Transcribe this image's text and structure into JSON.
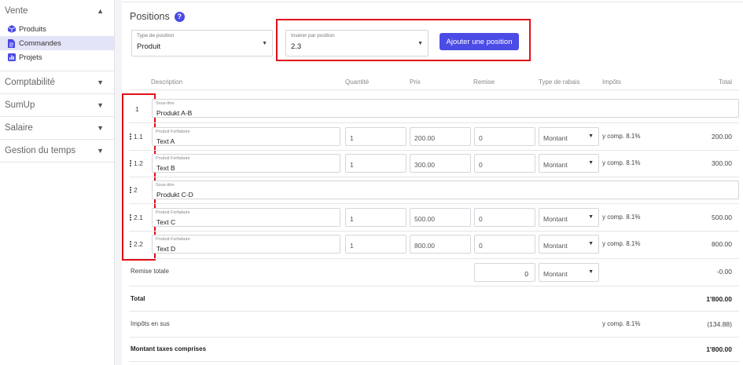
{
  "sidebar": {
    "vente": {
      "label": "Vente",
      "items": [
        {
          "label": "Produits",
          "icon": "cube-icon"
        },
        {
          "label": "Commandes",
          "icon": "document-icon",
          "active": true
        },
        {
          "label": "Projets",
          "icon": "bar-chart-icon"
        }
      ]
    },
    "groups": [
      "Comptabilité",
      "SumUp",
      "Salaire",
      "Gestion du temps"
    ]
  },
  "main": {
    "title": "Positions",
    "type_position": {
      "label": "Type de position",
      "value": "Produit"
    },
    "insert_position": {
      "label": "Insérer par position",
      "value": "2.3"
    },
    "add_button": "Ajouter une position",
    "headers": {
      "description": "Description",
      "quantite": "Quantité",
      "prix": "Prix",
      "remise": "Remise",
      "type_rabais": "Type de rabais",
      "impots": "Impôts",
      "total": "Total"
    },
    "rows": [
      {
        "num": "1",
        "type": "subtitle",
        "small": "Sous-titre",
        "text": "Produkt A-B"
      },
      {
        "num": "1.1",
        "type": "item",
        "small": "Produit Forfaitaire",
        "text": "Text A",
        "qty": "1",
        "price": "200.00",
        "discount": "0",
        "rabais": "Montant",
        "tax": "y comp. 8.1%",
        "total": "200.00"
      },
      {
        "num": "1.2",
        "type": "item",
        "small": "Produit Forfaitaire",
        "text": "Text B",
        "qty": "1",
        "price": "300.00",
        "discount": "0",
        "rabais": "Montant",
        "tax": "y comp. 8.1%",
        "total": "300.00"
      },
      {
        "num": "2",
        "type": "subtitle",
        "small": "Sous-titre",
        "text": "Produkt C-D"
      },
      {
        "num": "2.1",
        "type": "item",
        "small": "Produit Forfaitaire",
        "text": "Text C",
        "qty": "1",
        "price": "500.00",
        "discount": "0",
        "rabais": "Montant",
        "tax": "y comp. 8.1%",
        "total": "500.00"
      },
      {
        "num": "2.2",
        "type": "item",
        "small": "Produit Forfaitaire",
        "text": "Text D",
        "qty": "1",
        "price": "800.00",
        "discount": "0",
        "rabais": "Montant",
        "tax": "y comp. 8.1%",
        "total": "800.00"
      }
    ],
    "remise_totale": {
      "label": "Remise totale",
      "value": "0",
      "rabais": "Montant",
      "total": "-0.00"
    },
    "total": {
      "label": "Total",
      "value": "1'800.00"
    },
    "impots_sus": {
      "label": "Impôts en sus",
      "tax": "y comp. 8.1%",
      "value": "(134.88)"
    },
    "montant_ttc": {
      "label": "Montant taxes comprises",
      "value": "1'800.00"
    }
  }
}
